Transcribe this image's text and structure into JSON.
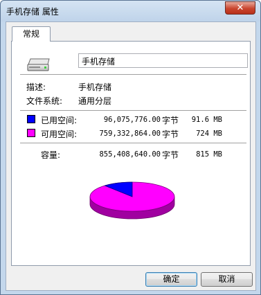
{
  "window": {
    "title": "手机存储 属性",
    "close_glyph": "✕"
  },
  "tabs": [
    {
      "label": "常规",
      "selected": true
    }
  ],
  "device": {
    "name": "手机存储",
    "icon": "drive-icon"
  },
  "info": {
    "description_label": "描述:",
    "description_value": "手机存储",
    "filesystem_label": "文件系统:",
    "filesystem_value": "通用分层"
  },
  "space": {
    "used": {
      "label": "已用空间:",
      "bytes": "96,075,776.00",
      "unit": "字节",
      "human": "91.6 MB",
      "color": "#0000ff"
    },
    "free": {
      "label": "可用空间:",
      "bytes": "759,332,864.00",
      "unit": "字节",
      "human": "724 MB",
      "color": "#ff00ff"
    },
    "capacity": {
      "label": "容量:",
      "bytes": "855,408,640.00",
      "unit": "字节",
      "human": "815 MB"
    },
    "used_fraction": 0.1123
  },
  "buttons": {
    "ok": "确定",
    "cancel": "取消"
  }
}
